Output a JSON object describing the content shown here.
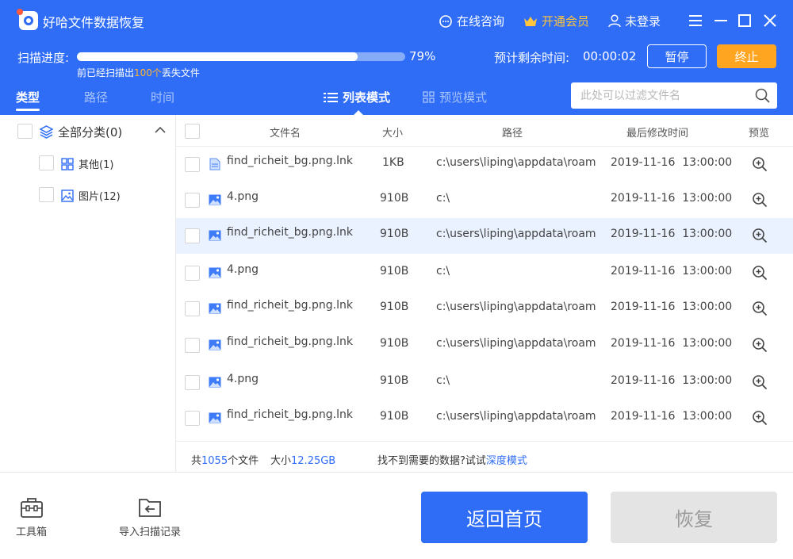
{
  "app": {
    "title": "好哈文件数据恢复"
  },
  "titlebar": {
    "consult": "在线咨询",
    "vip": "开通会员",
    "login": "未登录"
  },
  "scan": {
    "label": "扫描进度:",
    "percent_value": 79,
    "percent_text": "79%",
    "sub_prefix": "前已经扫描出",
    "sub_count": "100个",
    "sub_suffix": "丢失文件",
    "remain_label": "预计剩余时间:",
    "remain_value": "00:00:02",
    "pause": "暂停",
    "stop": "终止"
  },
  "tabs": [
    "类型",
    "路径",
    "时间"
  ],
  "view_modes": {
    "list": "列表模式",
    "preview": "预览模式"
  },
  "filter": {
    "placeholder": "此处可以过滤文件名"
  },
  "sidebar": {
    "root": "全部分类(0)",
    "items": [
      {
        "label": "其他(1)",
        "icon": "grid-icon"
      },
      {
        "label": "图片(12)",
        "icon": "image-icon"
      }
    ]
  },
  "table": {
    "headers": {
      "name": "文件名",
      "size": "大小",
      "path": "路径",
      "mtime": "最后修改时间",
      "preview": "预览"
    },
    "rows": [
      {
        "name": "find_richeit_bg.png.lnk",
        "size": "1KB",
        "path": "c:\\users\\liping\\appdata\\roam",
        "mtime": "2019-11-16  13:00:00",
        "icon": "doc-icon"
      },
      {
        "name": "4.png",
        "size": "910B",
        "path": "c:\\",
        "mtime": "2019-11-16  13:00:00",
        "icon": "image-icon"
      },
      {
        "name": "find_richeit_bg.png.lnk",
        "size": "910B",
        "path": "c:\\users\\liping\\appdata\\roam",
        "mtime": "2019-11-16  13:00:00",
        "icon": "image-icon"
      },
      {
        "name": "4.png",
        "size": "910B",
        "path": "c:\\",
        "mtime": "2019-11-16  13:00:00",
        "icon": "image-icon"
      },
      {
        "name": "find_richeit_bg.png.lnk",
        "size": "910B",
        "path": "c:\\users\\liping\\appdata\\roam",
        "mtime": "2019-11-16  13:00:00",
        "icon": "image-icon"
      },
      {
        "name": "find_richeit_bg.png.lnk",
        "size": "910B",
        "path": "c:\\users\\liping\\appdata\\roam",
        "mtime": "2019-11-16  13:00:00",
        "icon": "image-icon"
      },
      {
        "name": "4.png",
        "size": "910B",
        "path": "c:\\",
        "mtime": "2019-11-16  13:00:00",
        "icon": "image-icon"
      },
      {
        "name": "find_richeit_bg.png.lnk",
        "size": "910B",
        "path": "c:\\users\\liping\\appdata\\roam",
        "mtime": "2019-11-16  13:00:00",
        "icon": "image-icon"
      }
    ]
  },
  "summary": {
    "total_prefix": "共",
    "total_count": "1055",
    "total_suffix": "个文件",
    "size_prefix": "大小",
    "size_value": "12.25GB",
    "hint": "找不到需要的数据?试试",
    "deep_mode": "深度模式"
  },
  "bottom": {
    "toolbox": "工具箱",
    "import": "导入扫描记录",
    "home": "返回首页",
    "recover": "恢复"
  },
  "colors": {
    "primary": "#2f6df6",
    "accent": "#ffa51f",
    "vip": "#ffc53d",
    "selected_row": "#eaf1ff"
  }
}
